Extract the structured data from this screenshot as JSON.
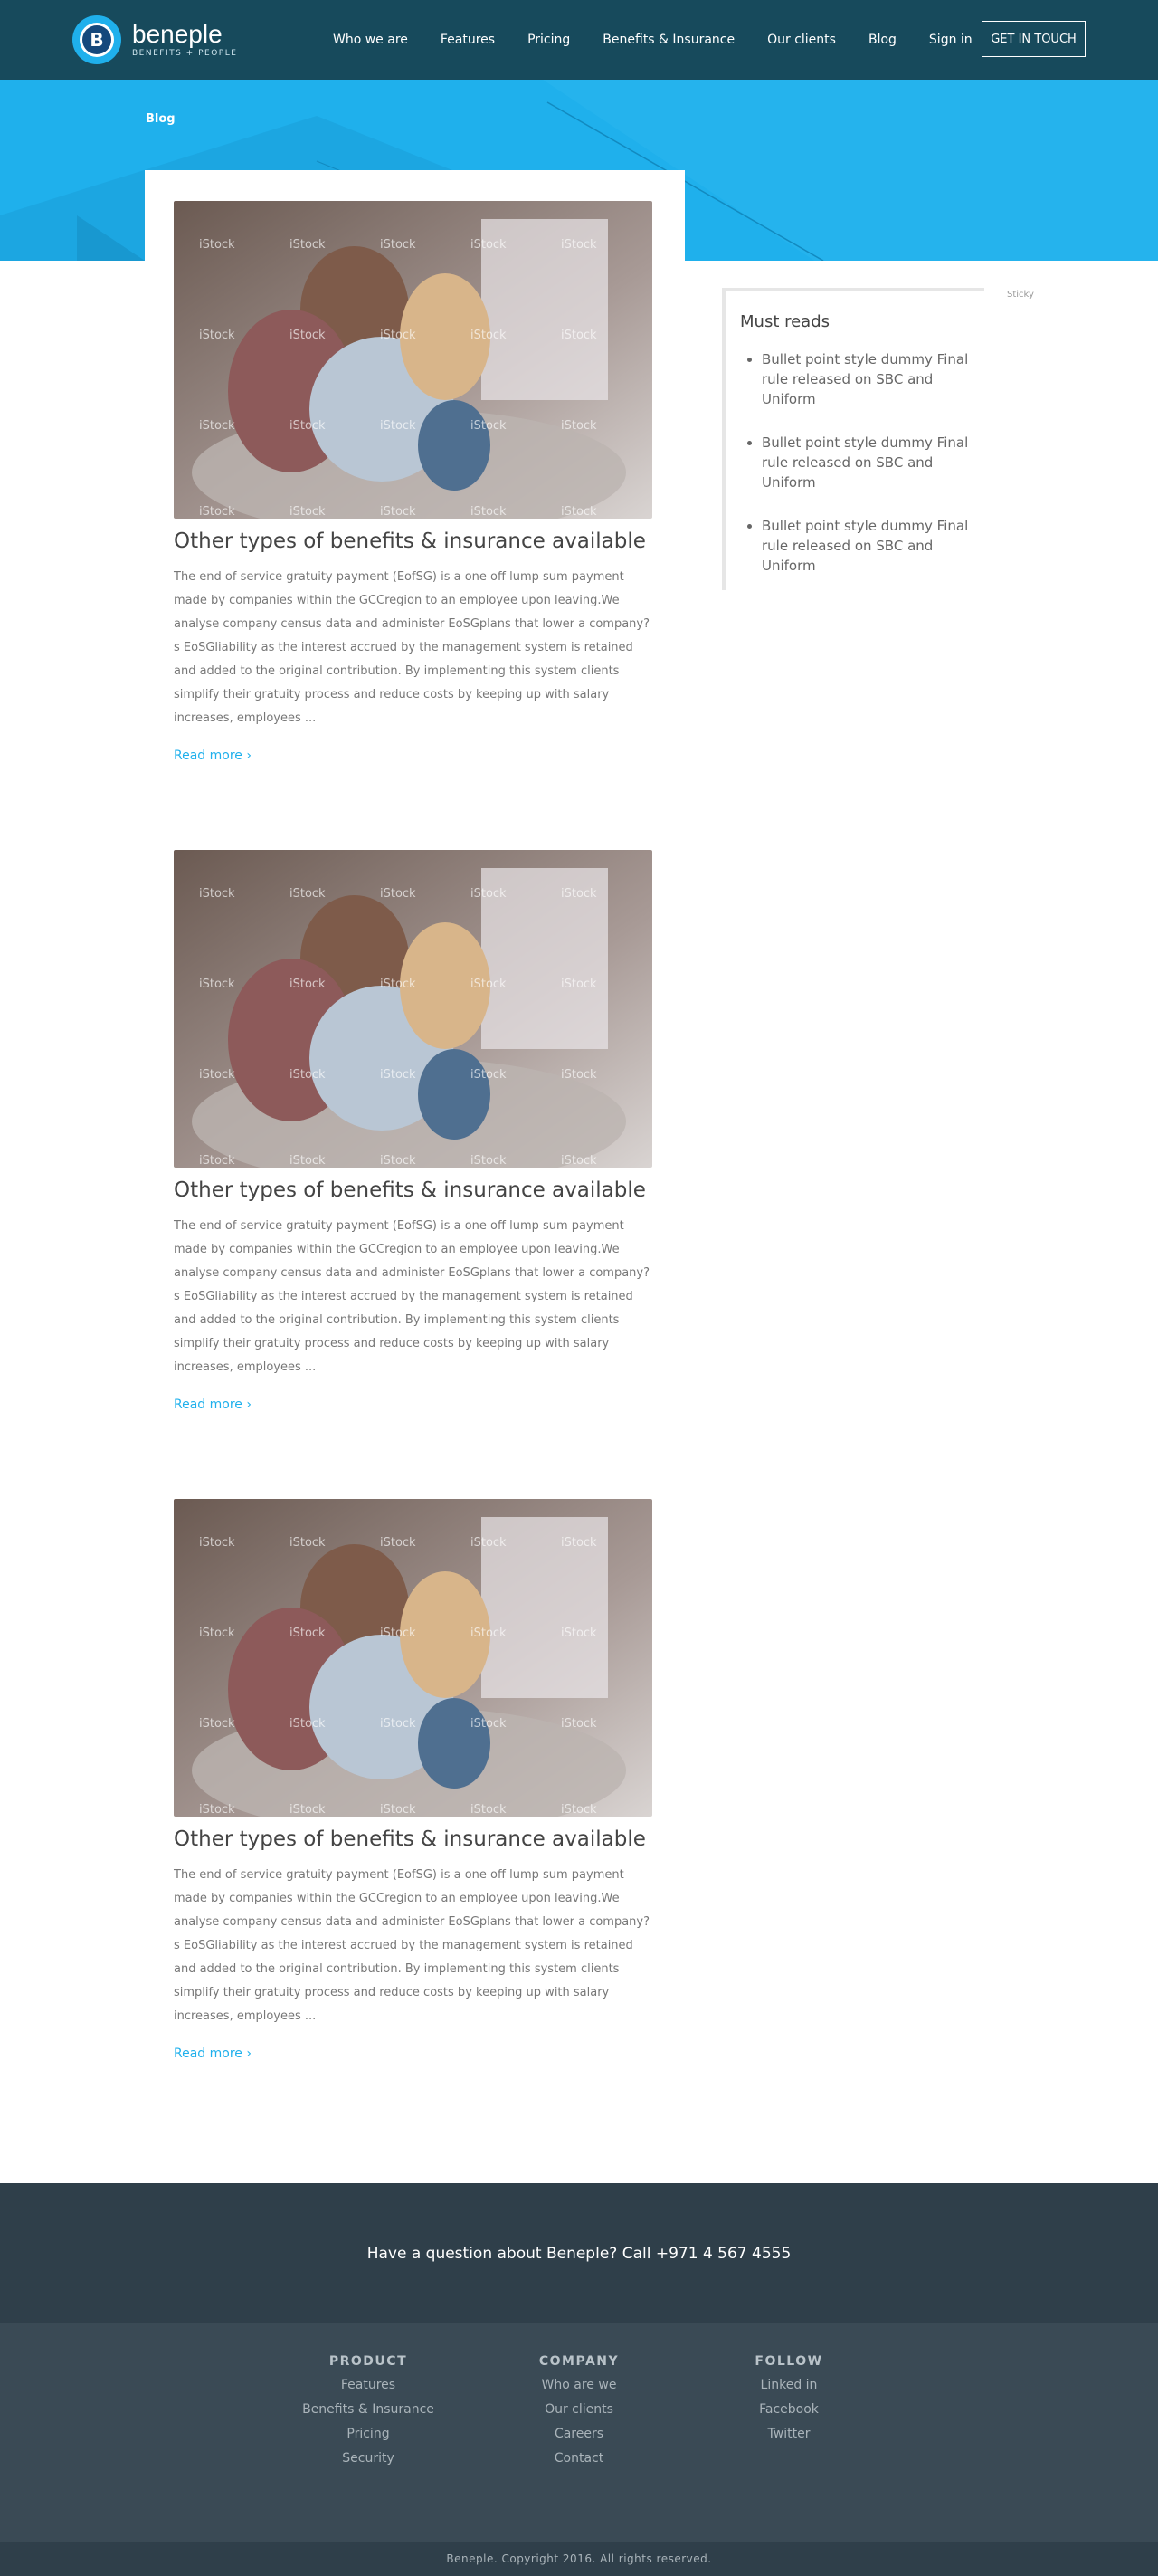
{
  "brand": {
    "logo_letter": "B",
    "name": "beneple",
    "tagline": "BENEFITS + PEOPLE",
    "colors": {
      "header": "#174a5c",
      "accent": "#1fb0ec",
      "footer": "#3a4a55"
    }
  },
  "nav": {
    "items": [
      "Who we are",
      "Features",
      "Pricing",
      "Benefits & Insurance",
      "Our clients",
      "Blog",
      "Sign in"
    ],
    "cta": "GET IN TOUCH"
  },
  "breadcrumb": "Blog",
  "posts": [
    {
      "image_icon": "family-photo",
      "watermark": "iStock",
      "title": "Other types of benefits & insurance available",
      "body": "The end of service gratuity payment (EofSG) is a one off lump sum payment made by companies within the GCCregion to an employee upon leaving.We analyse company census data and administer EoSGplans that lower a company?s EoSGliability as the interest accrued by the management system is retained and added to the original contribution. By implementing this system clients simplify their gratuity process and reduce costs by keeping up with salary increases, employees ...",
      "read_more": "Read more ›"
    },
    {
      "image_icon": "family-photo",
      "watermark": "iStock",
      "title": "Other types of benefits & insurance available",
      "body": "The end of service gratuity payment (EofSG) is a one off lump sum payment made by companies within the GCCregion to an employee upon leaving.We analyse company census data and administer EoSGplans that lower a company?s EoSGliability as the interest accrued by the management system is retained and added to the original contribution. By implementing this system clients simplify their gratuity process and reduce costs by keeping up with salary increases, employees ...",
      "read_more": "Read more ›"
    },
    {
      "image_icon": "family-photo",
      "watermark": "iStock",
      "title": "Other types of benefits & insurance available",
      "body": "The end of service gratuity payment (EofSG) is a one off lump sum payment made by companies within the GCCregion to an employee upon leaving.We analyse company census data and administer EoSGplans that lower a company?s EoSGliability as the interest accrued by the management system is retained and added to the original contribution. By implementing this system clients simplify their gratuity process and reduce costs by keeping up with salary increases, employees ...",
      "read_more": "Read more ›"
    }
  ],
  "sidebar": {
    "title": "Must reads",
    "items": [
      "Bullet point style dummy Final rule released on SBC and Uniform",
      "Bullet point style dummy Final rule released on SBC and Uniform",
      "Bullet point style dummy Final rule released on SBC and Uniform"
    ],
    "sticky_label": "Sticky"
  },
  "contact_bar": "Have a question about Beneple? Call +971 4 567 4555",
  "footer": {
    "columns": [
      {
        "heading": "PRODUCT",
        "links": [
          "Features",
          "Benefits & Insurance",
          "Pricing",
          "Security"
        ]
      },
      {
        "heading": "COMPANY",
        "links": [
          "Who are we",
          "Our clients",
          "Careers",
          "Contact"
        ]
      },
      {
        "heading": "FOLLOW",
        "links": [
          "Linked in",
          "Facebook",
          "Twitter"
        ]
      }
    ],
    "copyright": "Beneple. Copyright 2016. All rights reserved."
  }
}
